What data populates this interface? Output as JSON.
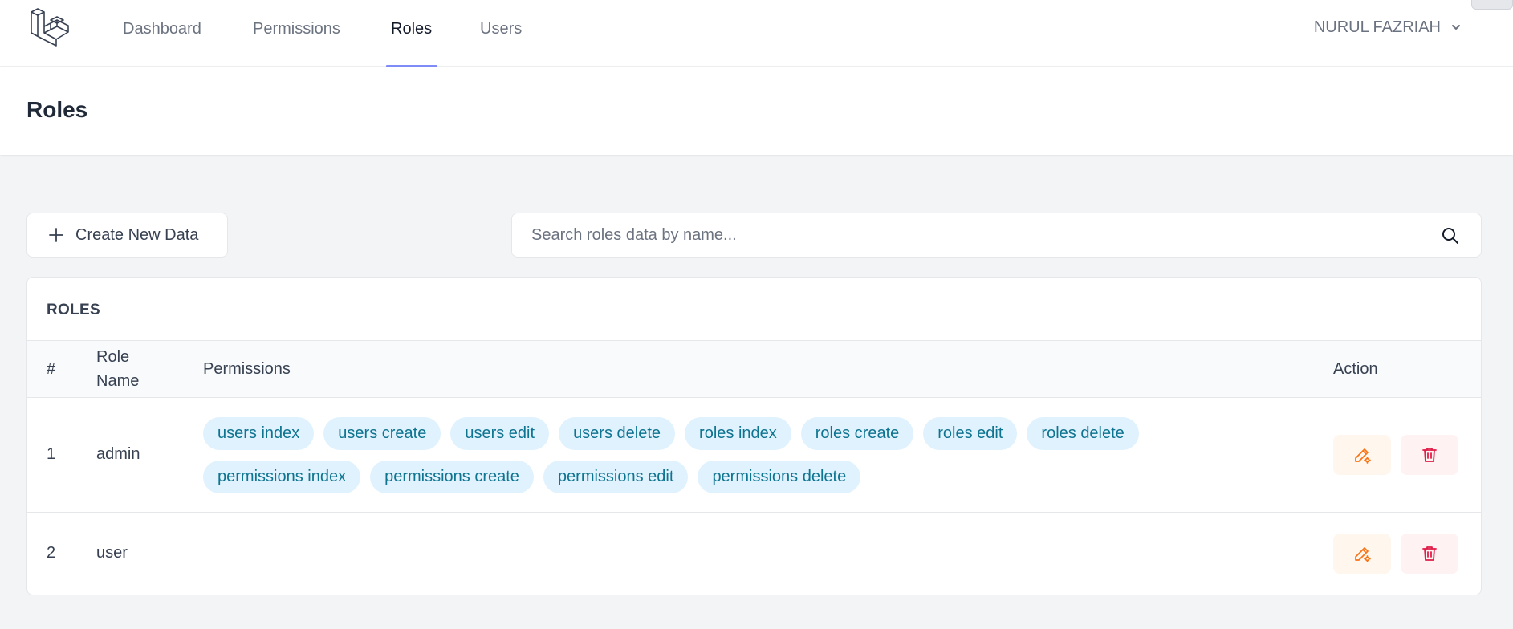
{
  "nav": {
    "links": [
      {
        "label": "Dashboard",
        "active": false
      },
      {
        "label": "Permissions",
        "active": false
      },
      {
        "label": "Roles",
        "active": true
      },
      {
        "label": "Users",
        "active": false
      }
    ],
    "user_name": "NURUL FAZRIAH",
    "active_color": "#818cf8"
  },
  "header": {
    "title": "Roles"
  },
  "toolbar": {
    "create_label": "Create New Data",
    "search_placeholder": "Search roles data by name..."
  },
  "table": {
    "title": "ROLES",
    "columns": {
      "index": "#",
      "role_name_line1": "Role",
      "role_name_line2": "Name",
      "permissions": "Permissions",
      "action": "Action"
    },
    "rows": [
      {
        "index": "1",
        "name": "admin",
        "permissions": [
          "users index",
          "users create",
          "users edit",
          "users delete",
          "roles index",
          "roles create",
          "roles edit",
          "roles delete",
          "permissions index",
          "permissions create",
          "permissions edit",
          "permissions delete"
        ]
      },
      {
        "index": "2",
        "name": "user",
        "permissions": []
      }
    ]
  },
  "colors": {
    "badge_bg": "#e0f2fe",
    "badge_text": "#0e7490",
    "edit_accent": "#f97316",
    "delete_accent": "#e11d48"
  },
  "icons": {
    "logo": "laravel-logo-icon",
    "user_menu": "chevron-down-icon",
    "create": "plus-icon",
    "search": "search-icon",
    "edit": "pencil-gear-icon",
    "delete": "trash-icon"
  }
}
